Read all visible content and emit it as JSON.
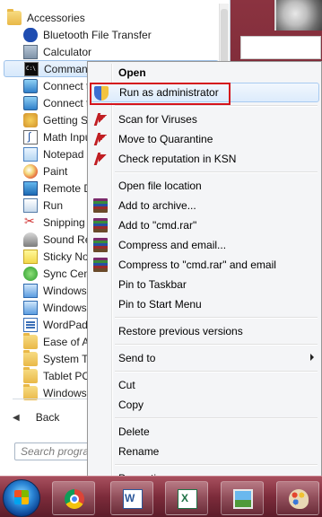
{
  "start_menu": {
    "programs": [
      {
        "label": "Accessories",
        "icon": "folder-icon",
        "level": "top"
      },
      {
        "label": "Bluetooth File Transfer",
        "icon": "bluetooth-icon",
        "level": "sub"
      },
      {
        "label": "Calculator",
        "icon": "calculator-icon",
        "level": "sub"
      },
      {
        "label": "Command Prompt",
        "icon": "command-prompt-icon",
        "level": "sub"
      },
      {
        "label": "Connect to a Network Projector",
        "icon": "network-projector-icon",
        "level": "sub"
      },
      {
        "label": "Connect to a Projector",
        "icon": "projector-icon",
        "level": "sub"
      },
      {
        "label": "Getting Started",
        "icon": "getting-started-icon",
        "level": "sub"
      },
      {
        "label": "Math Input Panel",
        "icon": "math-input-icon",
        "level": "sub"
      },
      {
        "label": "Notepad",
        "icon": "notepad-icon",
        "level": "sub"
      },
      {
        "label": "Paint",
        "icon": "paint-icon",
        "level": "sub"
      },
      {
        "label": "Remote Desktop Connection",
        "icon": "remote-desktop-icon",
        "level": "sub"
      },
      {
        "label": "Run",
        "icon": "run-icon",
        "level": "sub"
      },
      {
        "label": "Snipping Tool",
        "icon": "snipping-tool-icon",
        "level": "sub"
      },
      {
        "label": "Sound Recorder",
        "icon": "sound-recorder-icon",
        "level": "sub"
      },
      {
        "label": "Sticky Notes",
        "icon": "sticky-notes-icon",
        "level": "sub"
      },
      {
        "label": "Sync Center",
        "icon": "sync-center-icon",
        "level": "sub"
      },
      {
        "label": "Windows Explorer",
        "icon": "windows-explorer-icon",
        "level": "sub"
      },
      {
        "label": "Windows Mobility Center",
        "icon": "mobility-center-icon",
        "level": "sub"
      },
      {
        "label": "WordPad",
        "icon": "wordpad-icon",
        "level": "sub"
      },
      {
        "label": "Ease of Access",
        "icon": "folder-icon",
        "level": "sub"
      },
      {
        "label": "System Tools",
        "icon": "folder-icon",
        "level": "sub"
      },
      {
        "label": "Tablet PC",
        "icon": "folder-icon",
        "level": "sub"
      },
      {
        "label": "Windows PowerShell",
        "icon": "folder-icon",
        "level": "sub"
      }
    ],
    "selected_index": 3,
    "back_label": "Back",
    "search_placeholder": "Search programs and files"
  },
  "context_menu": {
    "items": [
      {
        "label": "Open",
        "bold": true,
        "icon": null
      },
      {
        "label": "Run as administrator",
        "icon": "uac-shield-icon",
        "highlighted": true
      },
      {
        "separator": true
      },
      {
        "label": "Scan for Viruses",
        "icon": "kaspersky-icon"
      },
      {
        "label": "Move to Quarantine",
        "icon": "kaspersky-icon"
      },
      {
        "label": "Check reputation in KSN",
        "icon": "kaspersky-icon"
      },
      {
        "separator": true
      },
      {
        "label": "Open file location",
        "icon": null
      },
      {
        "label": "Add to archive...",
        "icon": "winrar-icon"
      },
      {
        "label": "Add to \"cmd.rar\"",
        "icon": "winrar-icon"
      },
      {
        "label": "Compress and email...",
        "icon": "winrar-icon"
      },
      {
        "label": "Compress to \"cmd.rar\" and email",
        "icon": "winrar-icon"
      },
      {
        "label": "Pin to Taskbar",
        "icon": null
      },
      {
        "label": "Pin to Start Menu",
        "icon": null
      },
      {
        "separator": true
      },
      {
        "label": "Restore previous versions",
        "icon": null
      },
      {
        "separator": true
      },
      {
        "label": "Send to",
        "icon": null,
        "submenu": true
      },
      {
        "separator": true
      },
      {
        "label": "Cut",
        "icon": null
      },
      {
        "label": "Copy",
        "icon": null
      },
      {
        "separator": true
      },
      {
        "label": "Delete",
        "icon": null
      },
      {
        "label": "Rename",
        "icon": null
      },
      {
        "separator": true
      },
      {
        "label": "Properties",
        "icon": null
      }
    ]
  },
  "taskbar": {
    "start_icon": "windows-orb-icon",
    "buttons": [
      {
        "icon": "chrome-icon"
      },
      {
        "icon": "word-icon"
      },
      {
        "icon": "excel-icon"
      },
      {
        "icon": "photo-viewer-icon"
      },
      {
        "icon": "paint-palette-icon"
      }
    ]
  },
  "colors": {
    "highlight_border": "#d4131c",
    "taskbar": "#7c2b3a"
  }
}
